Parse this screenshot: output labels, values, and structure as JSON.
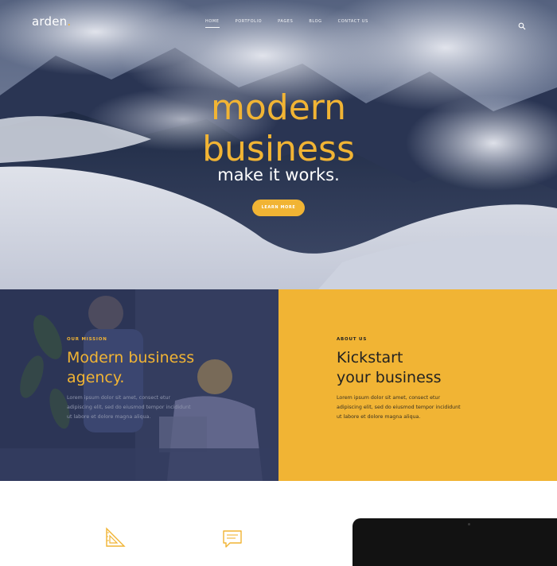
{
  "header": {
    "logo_text": "arden",
    "logo_dot": ".",
    "nav": [
      {
        "label": "HOME",
        "active": true
      },
      {
        "label": "PORTFOLIO",
        "active": false
      },
      {
        "label": "PAGES",
        "active": false
      },
      {
        "label": "BLOG",
        "active": false
      },
      {
        "label": "CONTACT US",
        "active": false
      }
    ],
    "search_icon": "search-icon"
  },
  "hero": {
    "title_line1": "modern",
    "title_line2": "business",
    "subtitle": "make it works.",
    "button_label": "LEARN MORE"
  },
  "mission": {
    "eyebrow": "OUR MISSION",
    "title_line1": "Modern business",
    "title_line2": "agency.",
    "body": "Lorem ipsum dolor sit amet, consect etur adipiscing elit, sed do eiusmod tempor incididunt ut labore et dolore magna aliqua."
  },
  "about": {
    "eyebrow": "ABOUT US",
    "title_line1": "Kickstart",
    "title_line2": "your business",
    "body": "Lorem ipsum dolor sit amet, consect etur adipiscing elit, sed do eiusmod tempor incididunt ut labore et dolore magna aliqua."
  },
  "features": {
    "icons": [
      "ruler-triangle-icon",
      "chat-bubble-icon"
    ]
  },
  "colors": {
    "accent": "#f1b434",
    "dark_panel": "#2c3556",
    "white": "#ffffff"
  }
}
